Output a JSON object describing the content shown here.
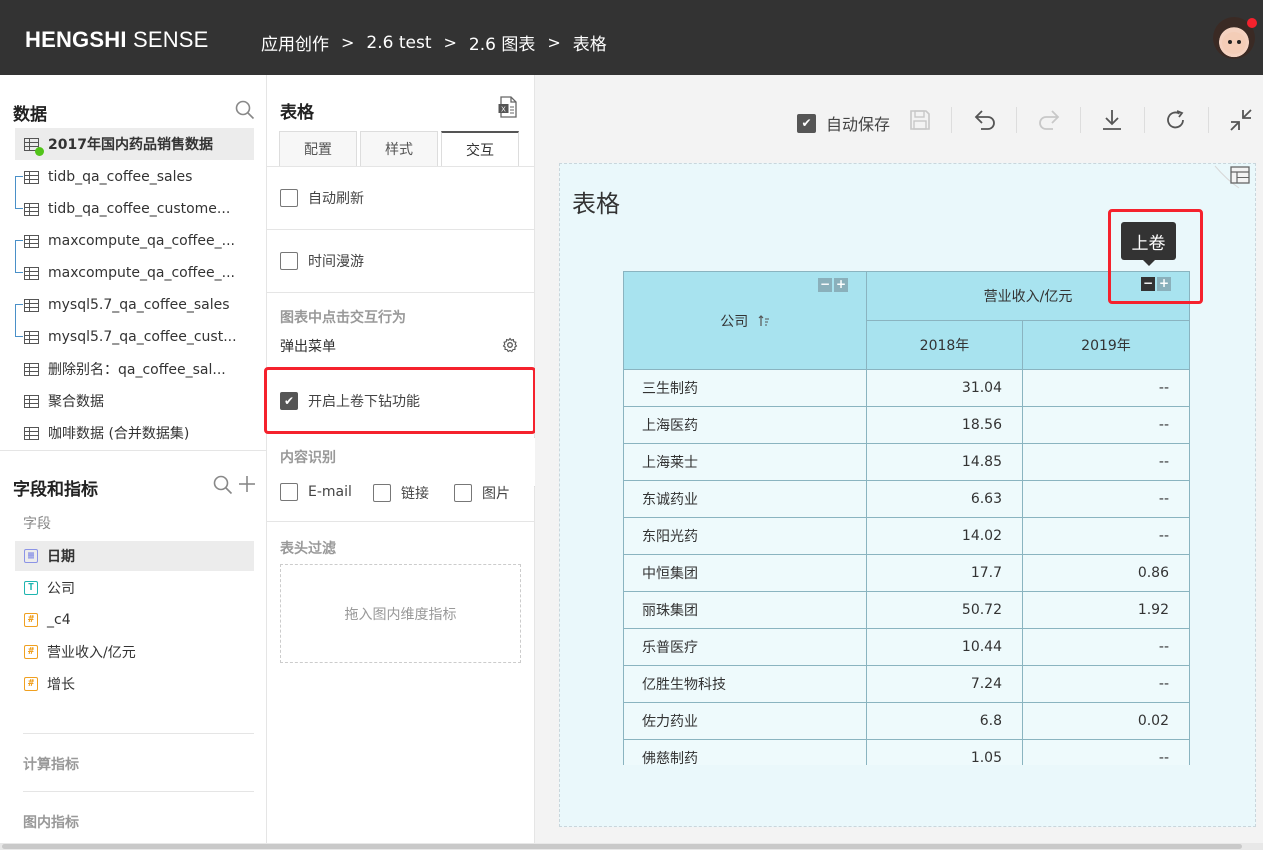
{
  "header": {
    "logo_bold": "HENGSHI",
    "logo_light": "SENSE",
    "breadcrumb": [
      "应用创作",
      "2.6 test",
      "2.6 图表",
      "表格"
    ],
    "separator": ">"
  },
  "data_panel": {
    "title": "数据",
    "datasets": [
      {
        "label": "2017年国内药品销售数据",
        "active": true
      },
      {
        "label": "tidb_qa_coffee_sales"
      },
      {
        "label": "tidb_qa_coffee_custome..."
      },
      {
        "label": "maxcompute_qa_coffee_..."
      },
      {
        "label": "maxcompute_qa_coffee_..."
      },
      {
        "label": "mysql5.7_qa_coffee_sales"
      },
      {
        "label": "mysql5.7_qa_coffee_cust..."
      },
      {
        "label": "删除别名：qa_coffee_sal..."
      },
      {
        "label": "聚合数据"
      },
      {
        "label": "咖啡数据 (合并数据集)"
      }
    ]
  },
  "fields_panel": {
    "title": "字段和指标",
    "fields_label": "字段",
    "fields": [
      {
        "label": "日期",
        "type": "date",
        "glyph": "▦"
      },
      {
        "label": "公司",
        "type": "text",
        "glyph": "T"
      },
      {
        "label": "_c4",
        "type": "num",
        "glyph": "#"
      },
      {
        "label": "营业收入/亿元",
        "type": "num",
        "glyph": "#"
      },
      {
        "label": "增长",
        "type": "num",
        "glyph": "#"
      }
    ],
    "calc_label": "计算指标",
    "inner_label": "图内指标"
  },
  "config_panel": {
    "title": "表格",
    "tabs": [
      "配置",
      "样式",
      "交互"
    ],
    "active_tab": "交互",
    "auto_refresh": "自动刷新",
    "time_roam": "时间漫游",
    "click_group_title": "图表中点击交互行为",
    "popup_menu": "弹出菜单",
    "drill_label": "开启上卷下钻功能",
    "content_title": "内容识别",
    "content_options": [
      "E-mail",
      "链接",
      "图片"
    ],
    "header_filter_title": "表头过滤",
    "drop_hint": "拖入图内维度指标"
  },
  "toolbar": {
    "autosave": "自动保存"
  },
  "chart": {
    "title": "表格",
    "tooltip": "上卷",
    "columns": {
      "company": "公司",
      "revenue": "营业收入/亿元",
      "y2018": "2018年",
      "y2019": "2019年"
    },
    "rows": [
      {
        "company": "三生制药",
        "y2018": "31.04",
        "y2019": "--"
      },
      {
        "company": "上海医药",
        "y2018": "18.56",
        "y2019": "--"
      },
      {
        "company": "上海莱士",
        "y2018": "14.85",
        "y2019": "--"
      },
      {
        "company": "东诚药业",
        "y2018": "6.63",
        "y2019": "--"
      },
      {
        "company": "东阳光药",
        "y2018": "14.02",
        "y2019": "--"
      },
      {
        "company": "中恒集团",
        "y2018": "17.7",
        "y2019": "0.86"
      },
      {
        "company": "丽珠集团",
        "y2018": "50.72",
        "y2019": "1.92"
      },
      {
        "company": "乐普医疗",
        "y2018": "10.44",
        "y2019": "--"
      },
      {
        "company": "亿胜生物科技",
        "y2018": "7.24",
        "y2019": "--"
      },
      {
        "company": "佐力药业",
        "y2018": "6.8",
        "y2019": "0.02"
      },
      {
        "company": "佛慈制药",
        "y2018": "1.05",
        "y2019": "--"
      }
    ]
  },
  "colors": {
    "topbar": "#333333",
    "header_cell": "#a8e3ef",
    "body_cell": "#eefafc",
    "highlight": "#f5222d"
  }
}
